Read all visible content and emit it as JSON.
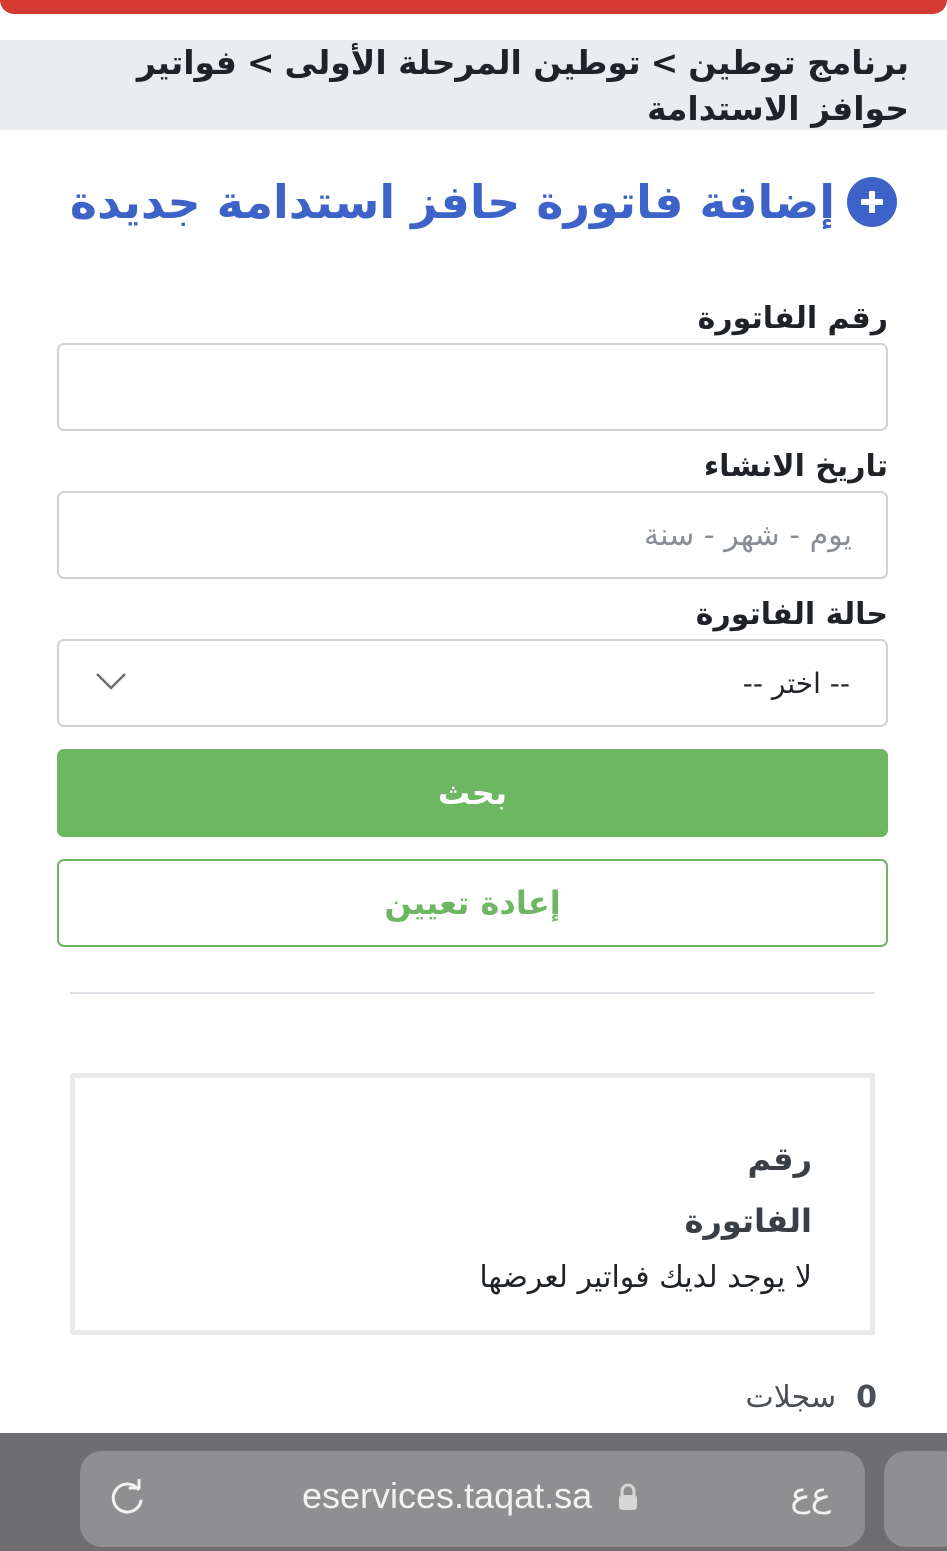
{
  "breadcrumb": {
    "item1": "برنامج توطين",
    "sep1": ">",
    "item2": "توطين المرحلة الأولى",
    "sep2": ">",
    "item3": "فواتير حوافز الاستدامة"
  },
  "page": {
    "title": "إضافة فاتورة حافز استدامة جديدة",
    "title_icon": "plus-circle-icon"
  },
  "form": {
    "invoice_number_label": "رقم الفاتورة",
    "invoice_number_value": "",
    "created_date_label": "تاريخ الانشاء",
    "created_date_placeholder": "يوم - شهر - سنة",
    "status_label": "حالة الفاتورة",
    "status_selected": "-- اختر --",
    "search_button": "بحث",
    "reset_button": "إعادة تعيين"
  },
  "results": {
    "column_header": "رقم الفاتورة",
    "empty_message": "لا يوجد لديك فواتير لعرضها"
  },
  "records": {
    "count": "0",
    "label": "سجلات"
  },
  "browser": {
    "url": "eservices.taqat.sa",
    "text_size_label": "ع‌ع",
    "reload_icon": "reload-icon",
    "lock_icon": "lock-icon"
  },
  "colors": {
    "accent_red": "#d43a2f",
    "title_blue": "#3d63c8",
    "button_green": "#6db662"
  }
}
